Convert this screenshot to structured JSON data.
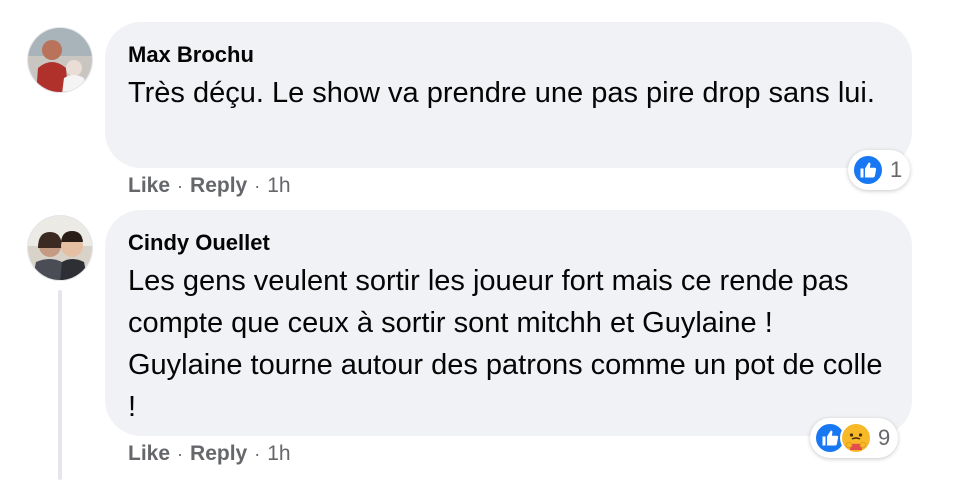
{
  "comments": [
    {
      "author": "Max Brochu",
      "text": "Très déçu. Le show va prendre une pas pire drop sans lui.",
      "actions": {
        "like": "Like",
        "reply": "Reply",
        "time": "1h"
      },
      "reactions": {
        "count": "1",
        "icons": [
          "like-icon"
        ]
      }
    },
    {
      "author": "Cindy Ouellet",
      "text": "Les gens veulent sortir les joueur fort mais ce rende pas compte que ceux à sortir sont mitchh et Guylaine ! Guylaine tourne autour des patrons comme un pot de colle !",
      "actions": {
        "like": "Like",
        "reply": "Reply",
        "time": "1h"
      },
      "reactions": {
        "count": "9",
        "icons": [
          "like-icon",
          "care-icon"
        ]
      }
    }
  ],
  "separator": "·",
  "colors": {
    "bubble": "#f0f2f5",
    "like_blue": "#1877f2",
    "care_yellow": "#f7b928",
    "meta_gray": "#65676b"
  }
}
